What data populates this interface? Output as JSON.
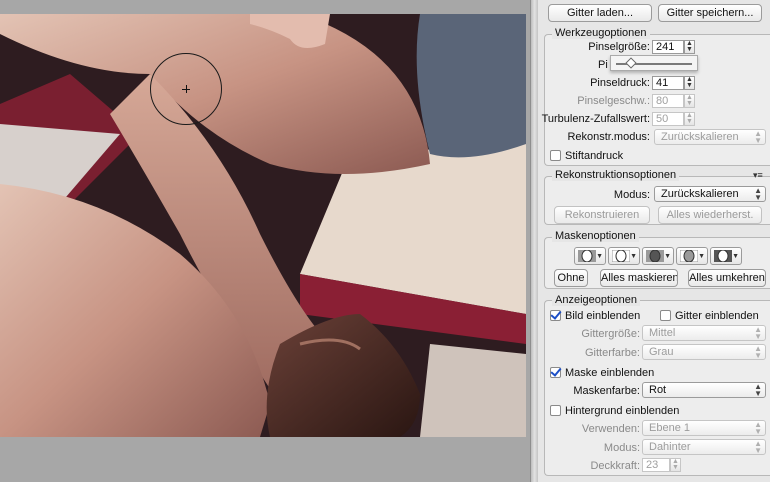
{
  "buttons_top": {
    "load_grid": "Gitter laden...",
    "save_grid": "Gitter speichern..."
  },
  "tool_options": {
    "title": "Werkzeugoptionen",
    "brush_size": {
      "label": "Pinselgröße:",
      "value": "241"
    },
    "brush_density_label_partial": "Pi",
    "brush_pressure": {
      "label": "Pinseldruck:",
      "value": "41"
    },
    "brush_rate": {
      "label": "Pinselgeschw.:",
      "value": "80"
    },
    "turbulence": {
      "label": "Turbulenz-Zufallswert:",
      "value": "50"
    },
    "reconstruct_mode": {
      "label": "Rekonstr.modus:",
      "value": "Zurückskalieren"
    },
    "stylus": {
      "label": "Stiftandruck",
      "checked": false
    },
    "slider_position": 0.2
  },
  "reconstruct_options": {
    "title": "Rekonstruktionsoptionen",
    "mode": {
      "label": "Modus:",
      "value": "Zurückskalieren"
    },
    "reconstruct_button": "Rekonstruieren",
    "restore_all_button": "Alles wiederherst."
  },
  "mask_options": {
    "title": "Maskenoptionen",
    "none_button": "Ohne",
    "mask_all_button": "Alles maskieren",
    "invert_all_button": "Alles umkehren"
  },
  "view_options": {
    "title": "Anzeigeoptionen",
    "show_image": {
      "label": "Bild einblenden",
      "checked": true
    },
    "show_grid": {
      "label": "Gitter einblenden",
      "checked": false
    },
    "grid_size": {
      "label": "Gittergröße:",
      "value": "Mittel"
    },
    "grid_color": {
      "label": "Gitterfarbe:",
      "value": "Grau"
    },
    "show_mask": {
      "label": "Maske einblenden",
      "checked": true
    },
    "mask_color": {
      "label": "Maskenfarbe:",
      "value": "Rot"
    },
    "show_backdrop": {
      "label": "Hintergrund einblenden",
      "checked": false
    },
    "use": {
      "label": "Verwenden:",
      "value": "Ebene 1"
    },
    "mode": {
      "label": "Modus:",
      "value": "Dahinter"
    },
    "opacity": {
      "label": "Deckkraft:",
      "value": "23"
    }
  }
}
